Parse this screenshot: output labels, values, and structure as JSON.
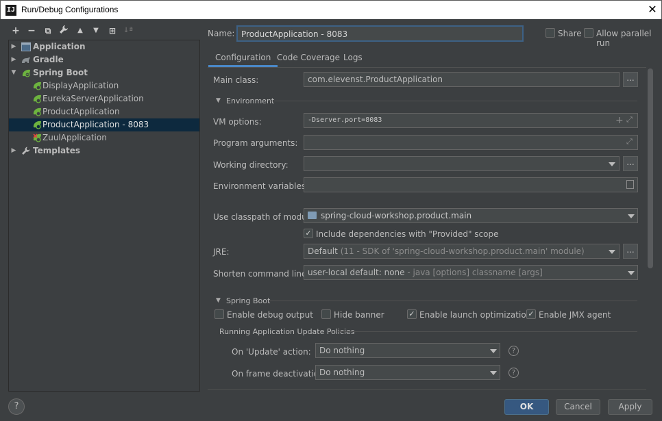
{
  "window": {
    "title": "Run/Debug Configurations",
    "logo": "IJ"
  },
  "toolbar": {
    "add": "+",
    "remove": "−",
    "copy": "⧉",
    "edit": "🔧",
    "up": "▲",
    "down": "▼",
    "folder": "⊞",
    "sort": "↓ª"
  },
  "tree": {
    "items": [
      {
        "label": "Application",
        "level": 0,
        "arrow": "▶",
        "bold": true,
        "icon": "application-icon"
      },
      {
        "label": "Gradle",
        "level": 0,
        "arrow": "▶",
        "bold": true,
        "icon": "gradle-icon"
      },
      {
        "label": "Spring Boot",
        "level": 0,
        "arrow": "▼",
        "bold": true,
        "icon": "spring-boot-icon"
      },
      {
        "label": "DisplayApplication",
        "level": 1,
        "icon": "spring-boot-icon"
      },
      {
        "label": "EurekaServerApplication",
        "level": 1,
        "icon": "spring-boot-icon"
      },
      {
        "label": "ProductApplication",
        "level": 1,
        "icon": "spring-boot-icon"
      },
      {
        "label": "ProductApplication - 8083",
        "level": 1,
        "icon": "spring-boot-icon",
        "selected": true
      },
      {
        "label": "ZuulApplication",
        "level": 1,
        "icon": "spring-boot-error-icon"
      },
      {
        "label": "Templates",
        "level": 0,
        "arrow": "▶",
        "bold": true,
        "icon": "wrench-icon"
      }
    ]
  },
  "header": {
    "name_label": "Name:",
    "name_value": "ProductApplication - 8083",
    "share_label": "Share",
    "parallel_label": "Allow parallel run"
  },
  "tabs": [
    {
      "label": "Configuration",
      "active": true
    },
    {
      "label": "Code Coverage"
    },
    {
      "label": "Logs"
    }
  ],
  "config": {
    "main_class_label": "Main class:",
    "main_class_value": "com.elevenst.ProductApplication",
    "browse_label": "...",
    "environment_section": "Environment",
    "vm_options_label": "VM options:",
    "vm_options_value": "-Dserver.port=8083",
    "program_args_label": "Program arguments:",
    "program_args_value": "",
    "working_dir_label": "Working directory:",
    "working_dir_value": "",
    "env_vars_label": "Environment variables:",
    "env_vars_value": "",
    "classpath_label": "Use classpath of module:",
    "classpath_value": "spring-cloud-workshop.product.main",
    "include_deps_label": "Include dependencies with \"Provided\" scope",
    "include_deps_checked": true,
    "jre_label": "JRE:",
    "jre_value": "Default",
    "jre_detail": "(11 - SDK of 'spring-cloud-workshop.product.main' module)",
    "shorten_label": "Shorten command line:",
    "shorten_value": "user-local default: none",
    "shorten_detail": " - java [options] classname [args]",
    "spring_boot_section": "Spring Boot",
    "debug_output_label": "Enable debug output",
    "debug_output_checked": false,
    "hide_banner_label": "Hide banner",
    "hide_banner_checked": false,
    "launch_opt_label": "Enable launch optimization",
    "launch_opt_checked": true,
    "jmx_label": "Enable JMX agent",
    "jmx_checked": true,
    "policies_section": "Running Application Update Policies",
    "update_action_label": "On 'Update' action:",
    "update_action_value": "Do nothing",
    "frame_deact_label": "On frame deactivation:",
    "frame_deact_value": "Do nothing"
  },
  "buttons": {
    "ok": "OK",
    "cancel": "Cancel",
    "apply": "Apply",
    "help": "?"
  },
  "colors": {
    "accent": "#365880",
    "selection": "#0d293e",
    "background": "#3c3f41",
    "focus": "#4a88c7",
    "spring": "#6db33f"
  }
}
